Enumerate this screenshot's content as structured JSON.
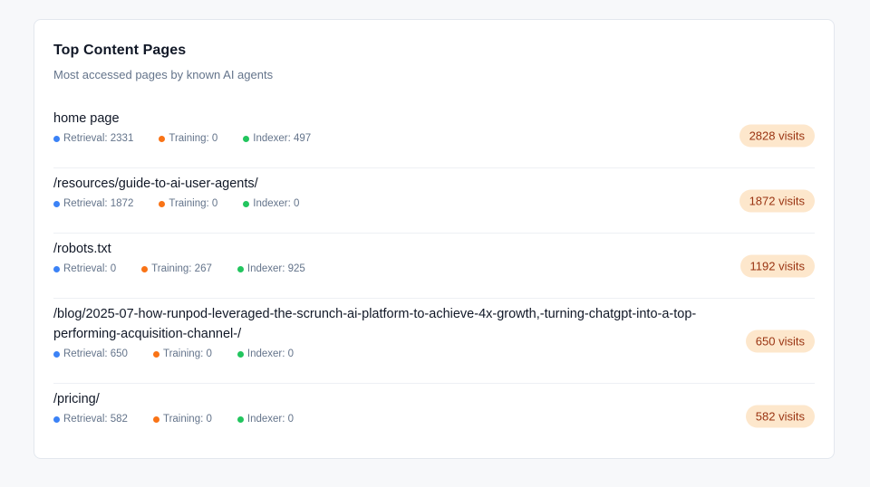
{
  "card": {
    "title": "Top Content Pages",
    "subtitle": "Most accessed pages by known AI agents"
  },
  "colors": {
    "retrieval": "#3b82f6",
    "training": "#f97316",
    "indexer": "#22c55e",
    "badge_bg": "#fde7cc",
    "badge_text": "#9a3412"
  },
  "pages": [
    {
      "path": "home page",
      "retrieval": "Retrieval: 2331",
      "training": "Training: 0",
      "indexer": "Indexer: 497",
      "visits": "2828 visits"
    },
    {
      "path": "/resources/guide-to-ai-user-agents/",
      "retrieval": "Retrieval: 1872",
      "training": "Training: 0",
      "indexer": "Indexer: 0",
      "visits": "1872 visits"
    },
    {
      "path": "/robots.txt",
      "retrieval": "Retrieval: 0",
      "training": "Training: 267",
      "indexer": "Indexer: 925",
      "visits": "1192 visits"
    },
    {
      "path": "/blog/2025-07-how-runpod-leveraged-the-scrunch-ai-platform-to-achieve-4x-growth,-turning-chatgpt-into-a-top-performing-acquisition-channel-/",
      "retrieval": "Retrieval: 650",
      "training": "Training: 0",
      "indexer": "Indexer: 0",
      "visits": "650 visits"
    },
    {
      "path": "/pricing/",
      "retrieval": "Retrieval: 582",
      "training": "Training: 0",
      "indexer": "Indexer: 0",
      "visits": "582 visits"
    }
  ]
}
